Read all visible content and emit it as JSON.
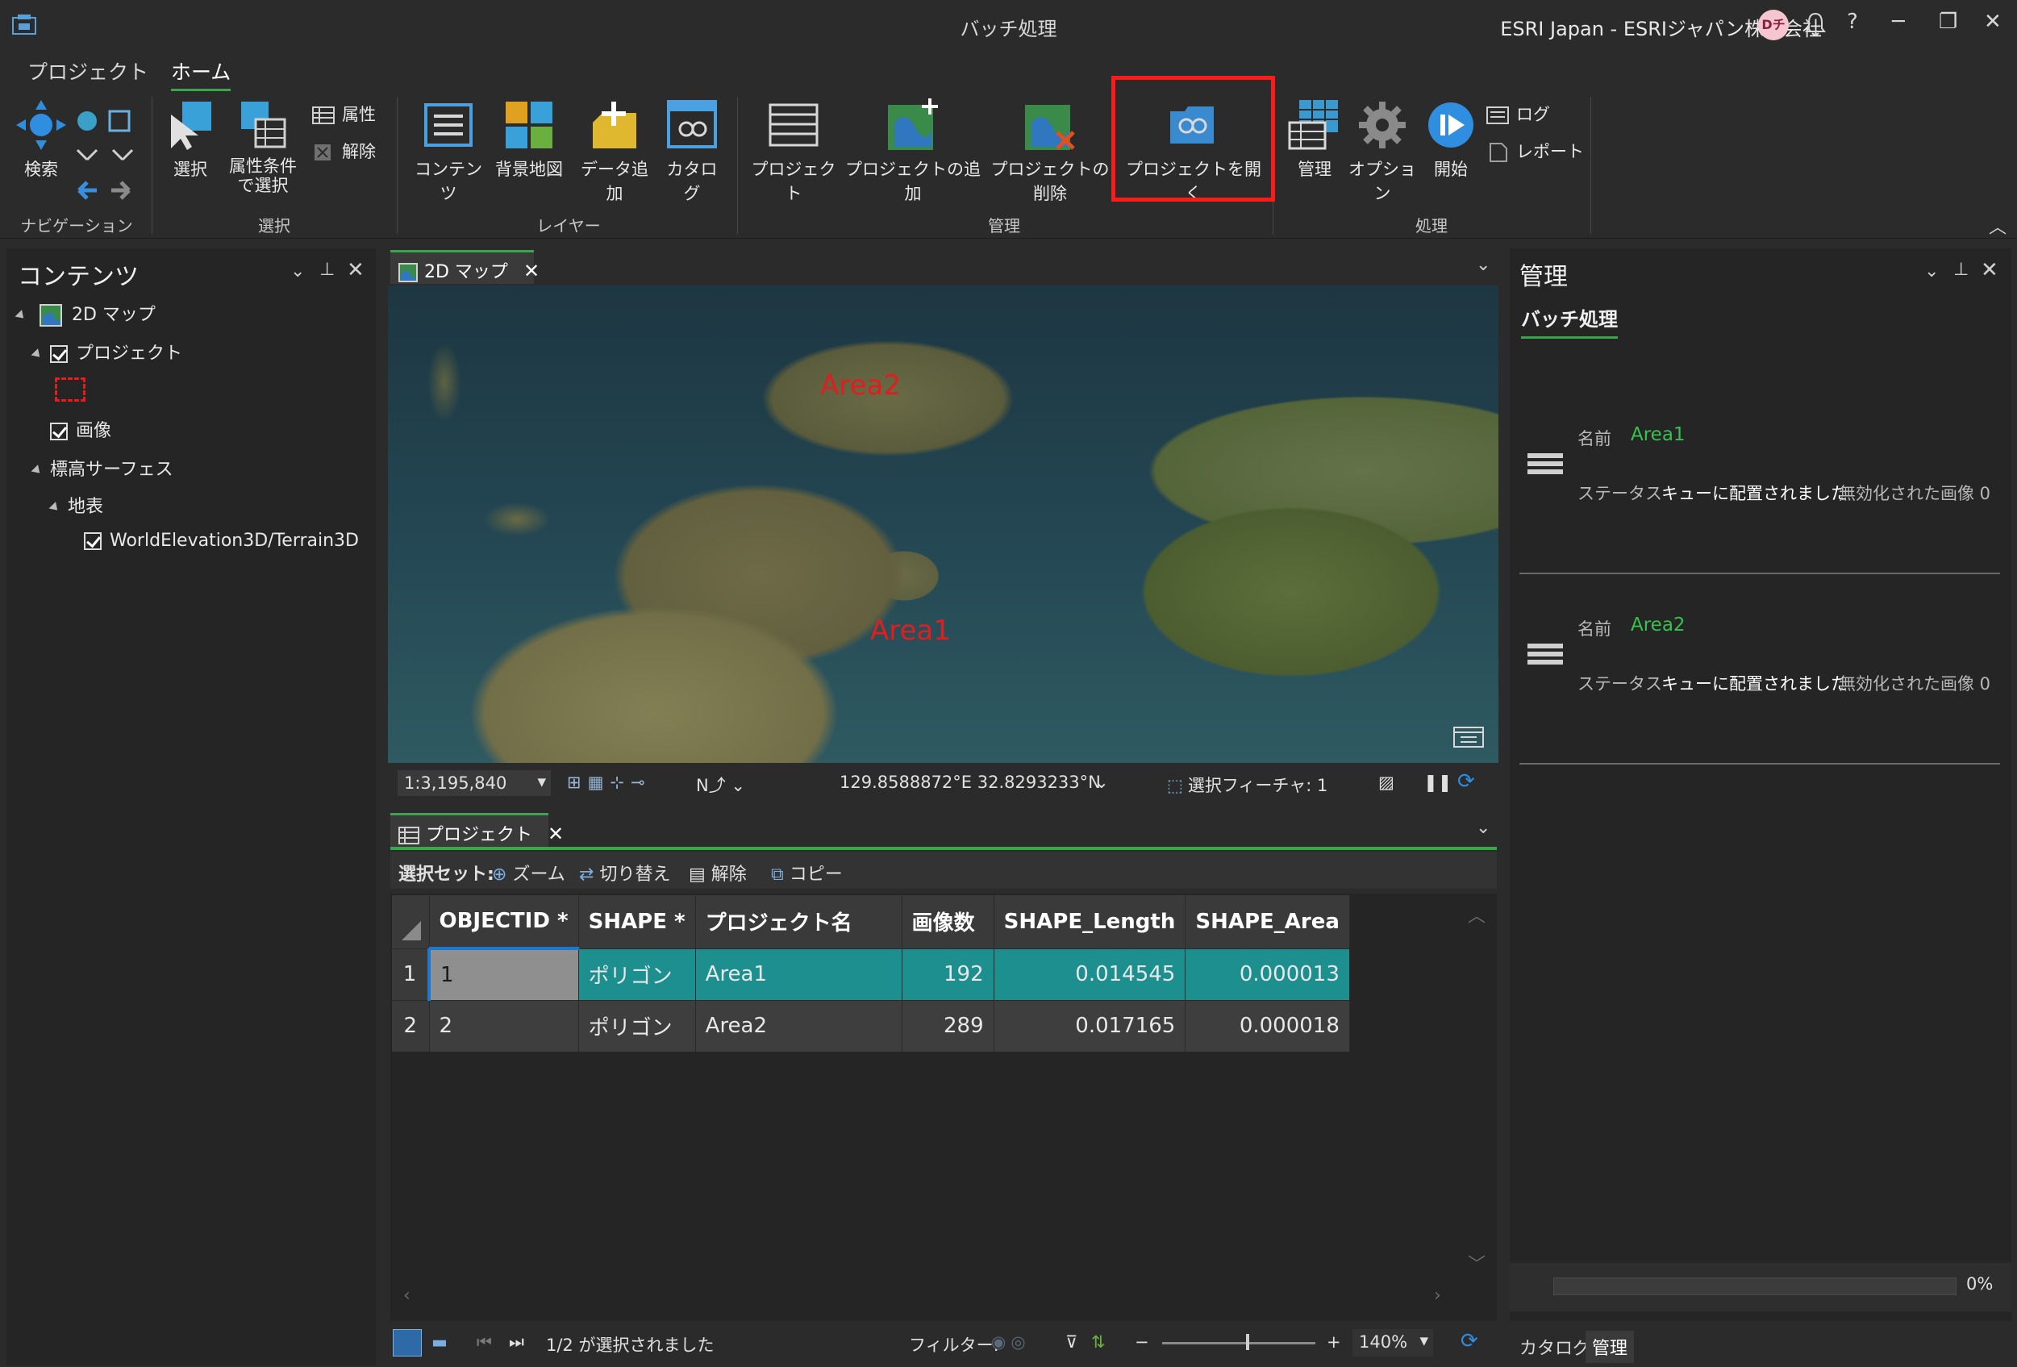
{
  "titlebar": {
    "title": "バッチ処理",
    "user": "ESRI Japan - ESRIジャパン株式会社",
    "avatar": "Dチ",
    "help": "?",
    "minimize": "─",
    "restore": "❐",
    "close": "✕"
  },
  "ribbon_tabs": [
    "プロジェクト",
    "ホーム"
  ],
  "ribbon": {
    "navigation": {
      "label": "ナビゲーション",
      "search": "検索"
    },
    "selection": {
      "label": "選択",
      "select": "選択",
      "select_by_attr_1": "属性条件",
      "select_by_attr_2": "で選択",
      "attributes": "属性",
      "clear": "解除"
    },
    "layer": {
      "label": "レイヤー",
      "contents": "コンテンツ",
      "basemap": "背景地図",
      "add_data": "データ追加",
      "catalog": "カタログ"
    },
    "manage": {
      "label": "管理",
      "project": "プロジェクト",
      "add_project": "プロジェクトの追加",
      "remove_project": "プロジェクトの削除",
      "open_project": "プロジェクトを開く"
    },
    "process": {
      "label": "処理",
      "manage": "管理",
      "options": "オプション",
      "start": "開始",
      "log": "ログ",
      "report": "レポート"
    }
  },
  "contents_pane": {
    "title": "コンテンツ",
    "tree": {
      "map": "2D マップ",
      "project_layer": "プロジェクト",
      "image_layer": "画像",
      "elevation": "標高サーフェス",
      "ground": "地表",
      "terrain": "WorldElevation3D/Terrain3D"
    }
  },
  "map_view": {
    "tab": "2D マップ",
    "labels": [
      "Area2",
      "Area1"
    ],
    "scale": "1:3,195,840",
    "coords": "129.8588872°E 32.8293233°N",
    "selected_features": "選択フィーチャ: 1"
  },
  "table_view": {
    "tab": "プロジェクト",
    "toolbar": {
      "selection_set": "選択セット:",
      "zoom": "ズーム",
      "switch": "切り替え",
      "clear": "解除",
      "copy": "コピー"
    },
    "columns": [
      "OBJECTID *",
      "SHAPE *",
      "プロジェクト名",
      "画像数",
      "SHAPE_Length",
      "SHAPE_Area"
    ],
    "rows": [
      {
        "n": "1",
        "objectid": "1",
        "shape": "ポリゴン",
        "name": "Area1",
        "images": "192",
        "length": "0.014545",
        "area": "0.000013"
      },
      {
        "n": "2",
        "objectid": "2",
        "shape": "ポリゴン",
        "name": "Area2",
        "images": "289",
        "length": "0.017165",
        "area": "0.000018"
      }
    ],
    "footer": {
      "selection": "1/2 が選択されました",
      "filter": "フィルター:",
      "zoom": "140%"
    }
  },
  "manage_pane": {
    "title": "管理",
    "tab": "バッチ処理",
    "jobs": [
      {
        "name_label": "名前",
        "name": "Area1",
        "status_label": "ステータス",
        "status": "キューに配置されました",
        "disabled_images": "無効化された画像 0"
      },
      {
        "name_label": "名前",
        "name": "Area2",
        "status_label": "ステータス",
        "status": "キューに配置されました",
        "disabled_images": "無効化された画像 0"
      }
    ],
    "progress": "0%"
  },
  "bottom_tabs": [
    "カタログ",
    "管理"
  ],
  "colors": {
    "accent_green": "#37a84a",
    "selection_teal": "#1e8f8f",
    "highlight_red": "#ff1a1a",
    "job_name_green": "#37c24d"
  }
}
